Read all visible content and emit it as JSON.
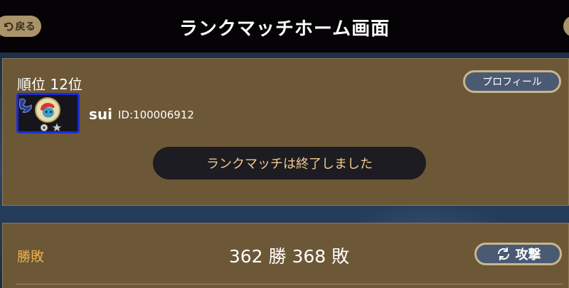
{
  "header": {
    "back_label": "戻る",
    "title": "ランクマッチホーム画面"
  },
  "player": {
    "rank_label": "順位 12位",
    "profile_button": "プロフィール",
    "username": "sui",
    "id_text": "ID:100006912",
    "frame_color": "#1a2bd8"
  },
  "status": {
    "message": "ランクマッチは終了しました"
  },
  "record": {
    "label": "勝敗",
    "value": "362 勝 368 敗",
    "attack_button": "攻撃"
  },
  "colors": {
    "header_bg": "#050305",
    "card_bg": "#6c5737",
    "button_bg": "#4b5a73",
    "accent_orange": "#f1b24a",
    "status_text": "#f3c98b"
  }
}
